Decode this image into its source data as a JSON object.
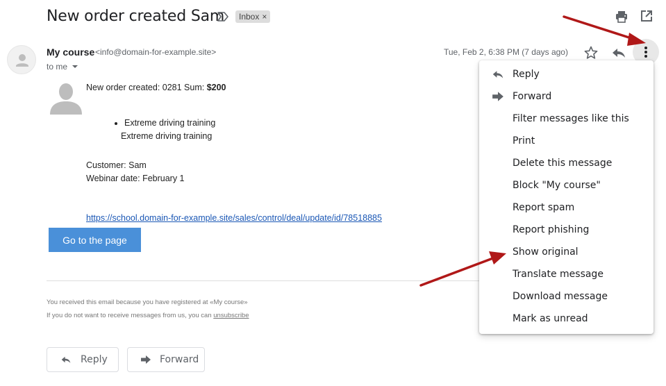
{
  "header": {
    "subject": "New order created Sam",
    "label_chip": "Inbox",
    "label_chip_close": "×"
  },
  "sender": {
    "name": "My course",
    "email": "<info@domain-for-example.site>",
    "to": "to me",
    "date": "Tue, Feb 2, 6:38 PM (7 days ago)"
  },
  "body": {
    "order_prefix": "New order created: 0281 Sum: ",
    "order_sum": "$200",
    "bullet_item": "Extreme driving training",
    "bullet_sub": "Extreme driving training",
    "customer": "Customer: Sam",
    "webinar": "Webinar date: February 1",
    "link": "https://school.domain-for-example.site/sales/control/deal/update/id/78518885",
    "cta": "Go to the page",
    "footer_line1": "You received this email because you have registered at «My course»",
    "footer_line2_prefix": "If you do not want to receive messages from us, you can ",
    "footer_unsubscribe": "unsubscribe"
  },
  "actions": {
    "reply": "Reply",
    "forward": "Forward"
  },
  "menu": {
    "items": [
      {
        "label": "Reply",
        "icon": "reply-icon"
      },
      {
        "label": "Forward",
        "icon": "forward-icon"
      },
      {
        "label": "Filter messages like this"
      },
      {
        "label": "Print"
      },
      {
        "label": "Delete this message"
      },
      {
        "label": "Block \"My course\""
      },
      {
        "label": "Report spam"
      },
      {
        "label": "Report phishing"
      },
      {
        "label": "Show original"
      },
      {
        "label": "Translate message"
      },
      {
        "label": "Download message"
      },
      {
        "label": "Mark as unread"
      }
    ]
  },
  "colors": {
    "arrow": "#b01818",
    "cta_bg": "#4a90d9",
    "link": "#1a57b5"
  }
}
